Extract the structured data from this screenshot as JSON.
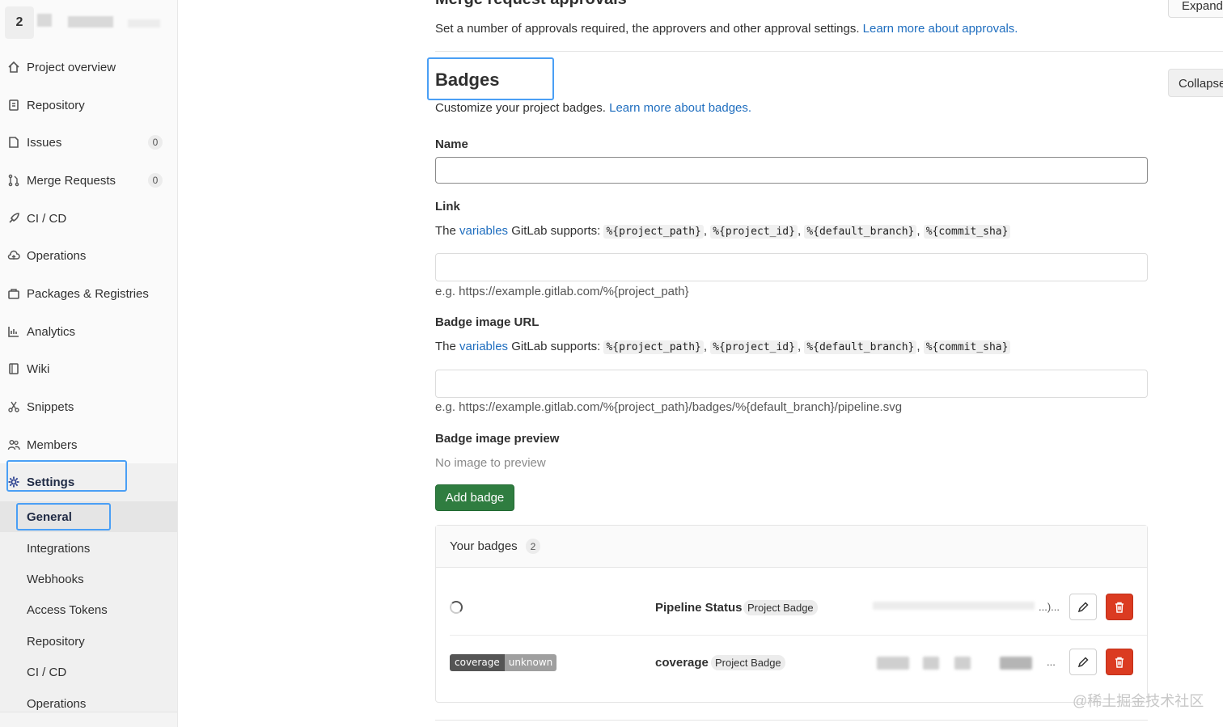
{
  "sidebar": {
    "project_avatar": "2",
    "items": [
      {
        "label": "Project overview",
        "icon": "home-icon"
      },
      {
        "label": "Repository",
        "icon": "document-icon"
      },
      {
        "label": "Issues",
        "icon": "issues-icon",
        "count": "0"
      },
      {
        "label": "Merge Requests",
        "icon": "merge-request-icon",
        "count": "0"
      },
      {
        "label": "CI / CD",
        "icon": "rocket-icon"
      },
      {
        "label": "Operations",
        "icon": "cloud-icon"
      },
      {
        "label": "Packages & Registries",
        "icon": "package-icon"
      },
      {
        "label": "Analytics",
        "icon": "chart-icon"
      },
      {
        "label": "Wiki",
        "icon": "book-icon"
      },
      {
        "label": "Snippets",
        "icon": "scissors-icon"
      },
      {
        "label": "Members",
        "icon": "users-icon"
      },
      {
        "label": "Settings",
        "icon": "gear-icon"
      }
    ],
    "settings_sub": [
      "General",
      "Integrations",
      "Webhooks",
      "Access Tokens",
      "Repository",
      "CI / CD",
      "Operations"
    ]
  },
  "merge": {
    "title": "Merge request approvals",
    "desc": "Set a number of approvals required, the approvers and other approval settings.",
    "learn_link": "Learn more about approvals.",
    "expand_label": "Expand"
  },
  "badges": {
    "title": "Badges",
    "collapse_label": "Collapse",
    "desc": "Customize your project badges.",
    "learn_link": "Learn more about badges.",
    "name_label": "Name",
    "link_label": "Link",
    "image_url_label": "Badge image URL",
    "vars_prefix": "The",
    "vars_link": "variables",
    "vars_suffix": "GitLab supports:",
    "vars": [
      "%{project_path}",
      "%{project_id}",
      "%{default_branch}",
      "%{commit_sha}"
    ],
    "link_example": "e.g. https://example.gitlab.com/%{project_path}",
    "image_example": "e.g. https://example.gitlab.com/%{project_path}/badges/%{default_branch}/pipeline.svg",
    "preview_label": "Badge image preview",
    "preview_empty": "No image to preview",
    "add_button": "Add badge",
    "your_badges_title": "Your badges",
    "your_badges_count": "2",
    "list": [
      {
        "name": "Pipeline Status",
        "kind": "Project Badge",
        "url_tail": "...)..."
      },
      {
        "name": "coverage",
        "kind": "Project Badge",
        "url_tail": "..."
      }
    ],
    "coverage_badge": {
      "left": "coverage",
      "right": "unknown"
    }
  },
  "watermark": "@稀土掘金技术社区"
}
